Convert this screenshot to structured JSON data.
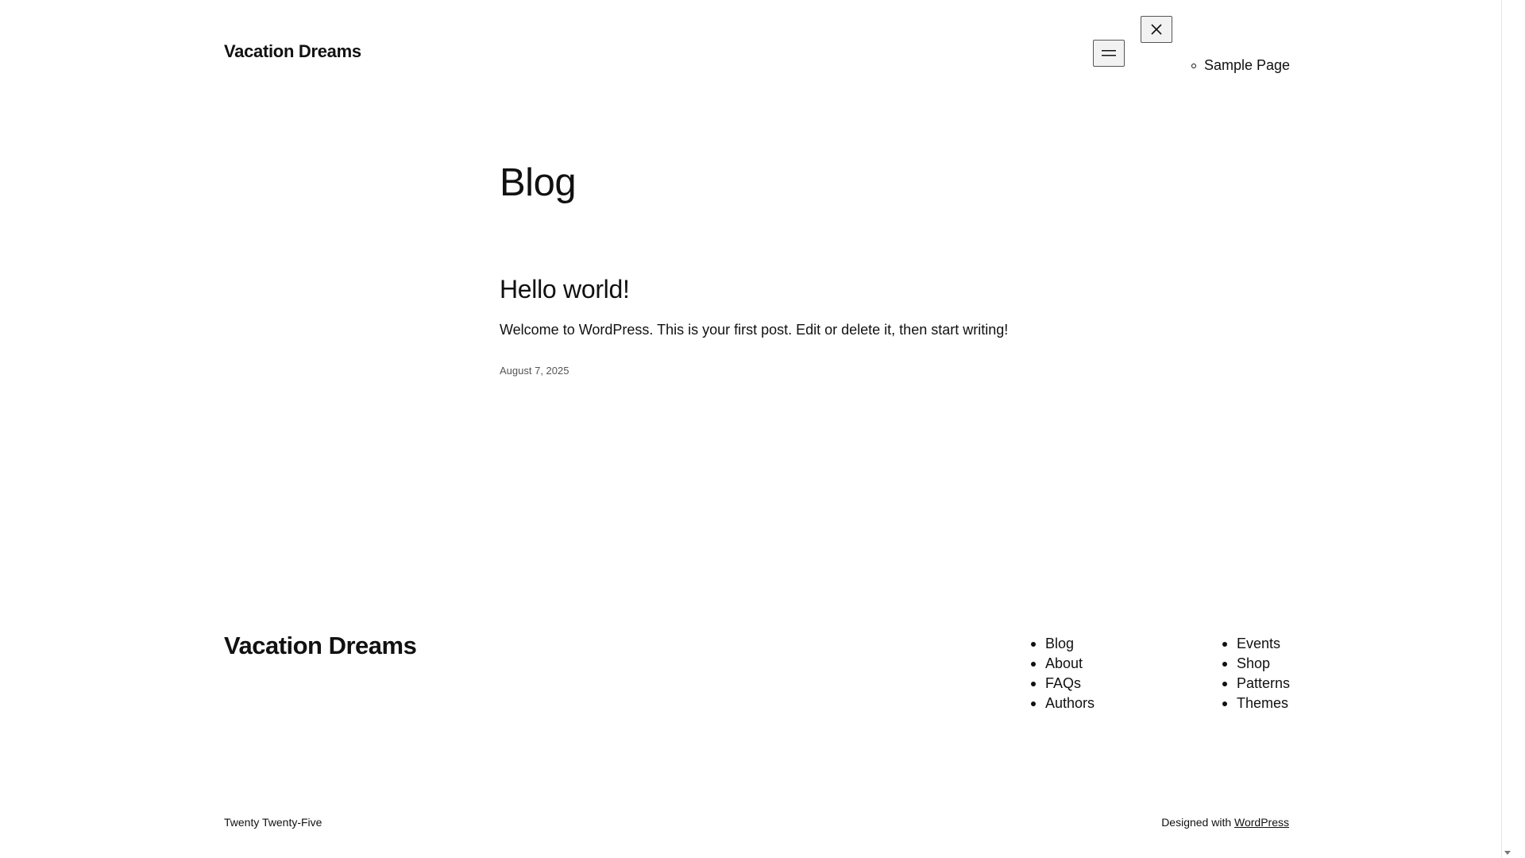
{
  "header": {
    "site_title": "Vacation Dreams",
    "menu_open_icon": "hamburger-icon",
    "menu_close_icon": "close-icon",
    "nav_items": [
      {
        "label": "Sample Page"
      }
    ]
  },
  "main": {
    "heading": "Blog",
    "posts": [
      {
        "title": "Hello world!",
        "excerpt": "Welcome to WordPress. This is your first post. Edit or delete it, then start writing!",
        "date": "August 7, 2025"
      }
    ]
  },
  "footer": {
    "site_title": "Vacation Dreams",
    "nav_column_1": [
      {
        "label": "Blog"
      },
      {
        "label": "About"
      },
      {
        "label": "FAQs"
      },
      {
        "label": "Authors"
      }
    ],
    "nav_column_2": [
      {
        "label": "Events"
      },
      {
        "label": "Shop"
      },
      {
        "label": "Patterns"
      },
      {
        "label": "Themes"
      }
    ],
    "theme_name": "Twenty Twenty-Five",
    "credit_prefix": "Designed with",
    "credit_link": "WordPress"
  }
}
